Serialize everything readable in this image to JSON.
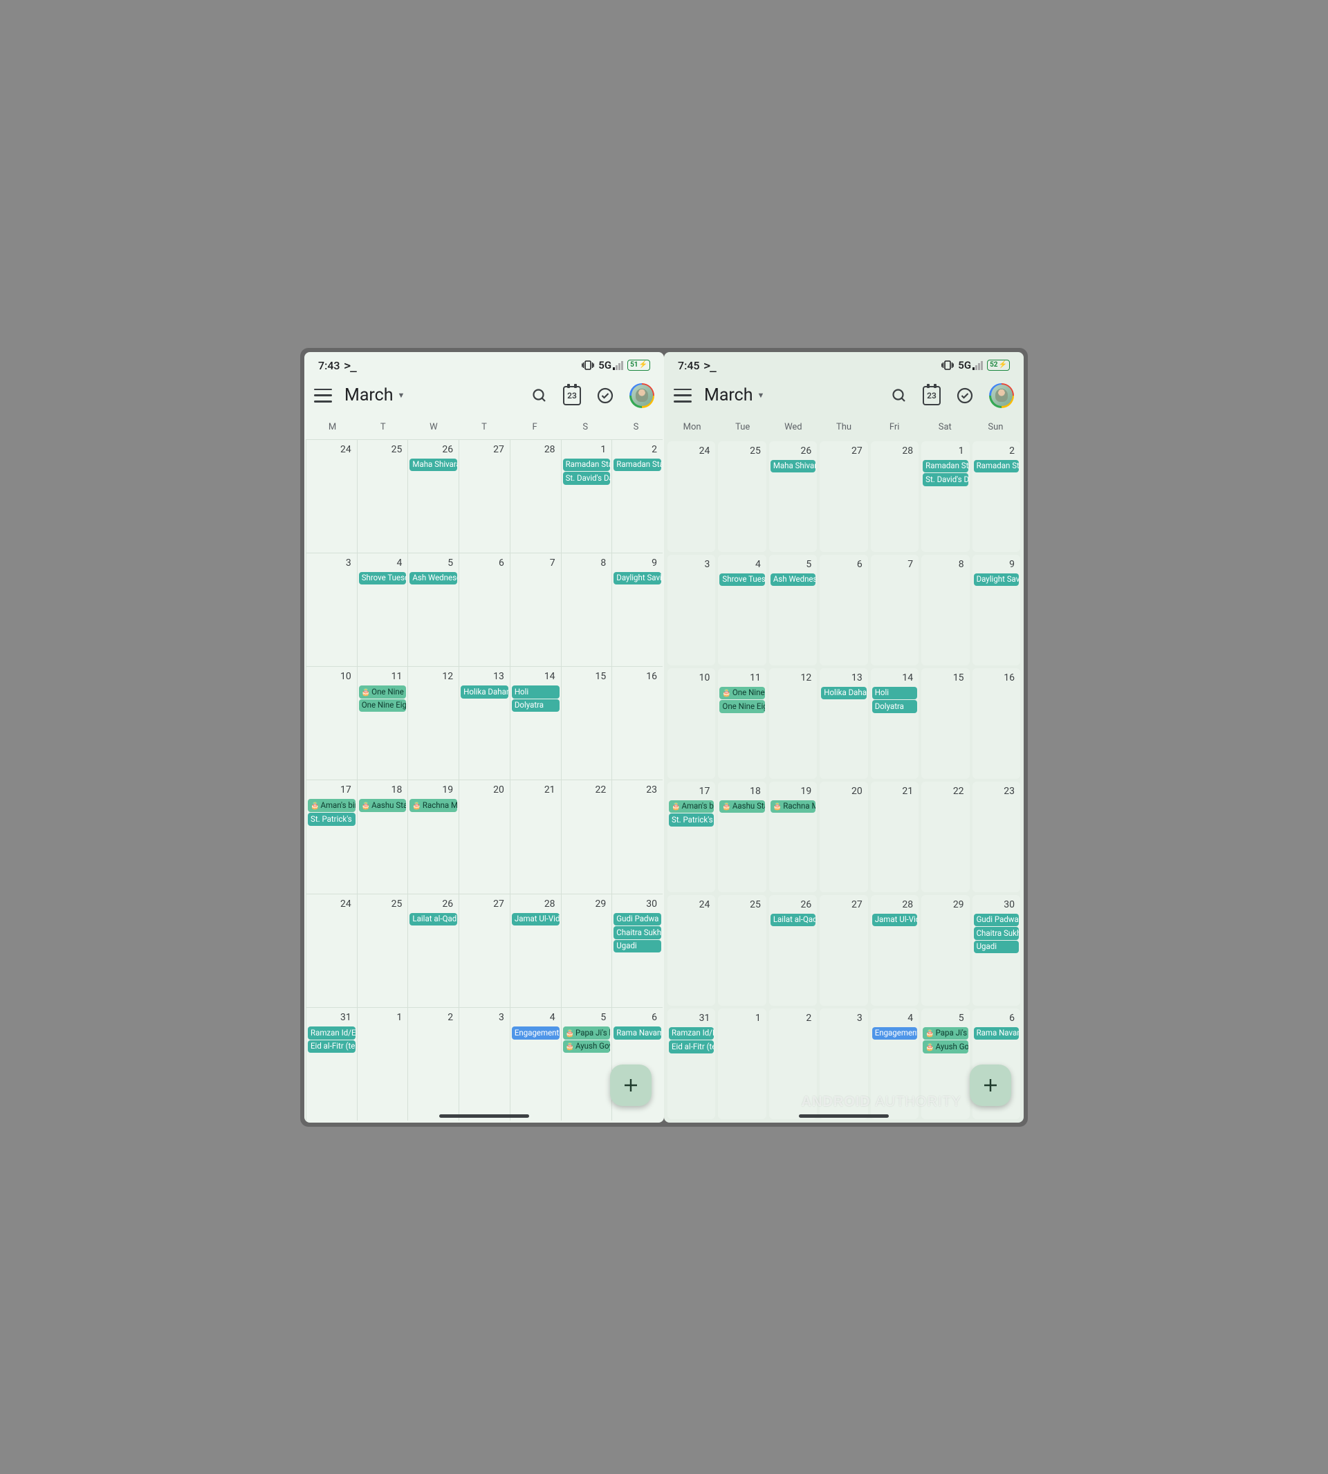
{
  "left": {
    "status": {
      "time": "7:43",
      "network": "5G",
      "battery": "51"
    },
    "header": {
      "month": "March",
      "today_num": "23"
    },
    "weekdays": [
      "M",
      "T",
      "W",
      "T",
      "F",
      "S",
      "S"
    ]
  },
  "right": {
    "status": {
      "time": "7:45",
      "network": "5G",
      "battery": "52"
    },
    "header": {
      "month": "March",
      "today_num": "23"
    },
    "weekdays": [
      "Mon",
      "Tue",
      "Wed",
      "Thu",
      "Fri",
      "Sat",
      "Sun"
    ]
  },
  "weeks": [
    {
      "days": [
        {
          "num": "24",
          "events": []
        },
        {
          "num": "25",
          "events": []
        },
        {
          "num": "26",
          "events": [
            {
              "label": "Maha Shivaratri",
              "cls": "ev-teal"
            }
          ]
        },
        {
          "num": "27",
          "events": []
        },
        {
          "num": "28",
          "events": []
        },
        {
          "num": "1",
          "events": [
            {
              "label": "Ramadan Start",
              "cls": "ev-teal"
            },
            {
              "label": "St. David's Day",
              "cls": "ev-teal"
            }
          ]
        },
        {
          "num": "2",
          "events": [
            {
              "label": "Ramadan Start",
              "cls": "ev-teal"
            }
          ]
        }
      ]
    },
    {
      "days": [
        {
          "num": "3",
          "events": []
        },
        {
          "num": "4",
          "events": [
            {
              "label": "Shrove Tuesday",
              "cls": "ev-teal"
            }
          ]
        },
        {
          "num": "5",
          "events": [
            {
              "label": "Ash Wednesday",
              "cls": "ev-teal"
            }
          ]
        },
        {
          "num": "6",
          "events": []
        },
        {
          "num": "7",
          "events": []
        },
        {
          "num": "8",
          "events": []
        },
        {
          "num": "9",
          "events": [
            {
              "label": "Daylight Saving",
              "cls": "ev-teal"
            }
          ]
        }
      ]
    },
    {
      "days": [
        {
          "num": "10",
          "events": []
        },
        {
          "num": "11",
          "events": [
            {
              "label": "One Nine",
              "cls": "ev-green",
              "bday": true
            },
            {
              "label": "One Nine Eight",
              "cls": "ev-green"
            }
          ]
        },
        {
          "num": "12",
          "events": []
        },
        {
          "num": "13",
          "events": [
            {
              "label": "Holika Dahan",
              "cls": "ev-teal"
            }
          ]
        },
        {
          "num": "14",
          "events": [
            {
              "label": "Holi",
              "cls": "ev-teal"
            },
            {
              "label": "Dolyatra",
              "cls": "ev-teal"
            }
          ]
        },
        {
          "num": "15",
          "events": []
        },
        {
          "num": "16",
          "events": []
        }
      ]
    },
    {
      "days": [
        {
          "num": "17",
          "events": [
            {
              "label": "Aman's birthday",
              "cls": "ev-green",
              "bday": true
            },
            {
              "label": "St. Patrick's",
              "cls": "ev-teal"
            }
          ]
        },
        {
          "num": "18",
          "events": [
            {
              "label": "Aashu Star",
              "cls": "ev-green",
              "bday": true
            }
          ]
        },
        {
          "num": "19",
          "events": [
            {
              "label": "Rachna M",
              "cls": "ev-green",
              "bday": true
            }
          ]
        },
        {
          "num": "20",
          "events": []
        },
        {
          "num": "21",
          "events": []
        },
        {
          "num": "22",
          "events": []
        },
        {
          "num": "23",
          "events": []
        }
      ]
    },
    {
      "days": [
        {
          "num": "24",
          "events": []
        },
        {
          "num": "25",
          "events": []
        },
        {
          "num": "26",
          "events": [
            {
              "label": "Lailat al-Qadr",
              "cls": "ev-teal"
            }
          ]
        },
        {
          "num": "27",
          "events": []
        },
        {
          "num": "28",
          "events": [
            {
              "label": "Jamat Ul-Vida",
              "cls": "ev-teal"
            }
          ]
        },
        {
          "num": "29",
          "events": []
        },
        {
          "num": "30",
          "events": [
            {
              "label": "Gudi Padwa",
              "cls": "ev-teal"
            },
            {
              "label": "Chaitra Sukhladi",
              "cls": "ev-teal"
            },
            {
              "label": "Ugadi",
              "cls": "ev-teal"
            }
          ]
        }
      ]
    },
    {
      "days": [
        {
          "num": "31",
          "events": [
            {
              "label": "Ramzan Id/Eid",
              "cls": "ev-teal"
            },
            {
              "label": "Eid al-Fitr (tentative)",
              "cls": "ev-teal"
            }
          ]
        },
        {
          "num": "1",
          "events": []
        },
        {
          "num": "2",
          "events": []
        },
        {
          "num": "3",
          "events": []
        },
        {
          "num": "4",
          "events": [
            {
              "label": "Engagement",
              "cls": "ev-blue"
            }
          ]
        },
        {
          "num": "5",
          "events": [
            {
              "label": "Papa Ji's birthday",
              "cls": "ev-green",
              "bday": true
            },
            {
              "label": "Ayush Goyal",
              "cls": "ev-green",
              "bday": true
            }
          ]
        },
        {
          "num": "6",
          "events": [
            {
              "label": "Rama Navami",
              "cls": "ev-teal"
            }
          ]
        }
      ]
    }
  ],
  "watermark": {
    "brand": "ANDROID",
    "site": "AUTHORITY"
  }
}
